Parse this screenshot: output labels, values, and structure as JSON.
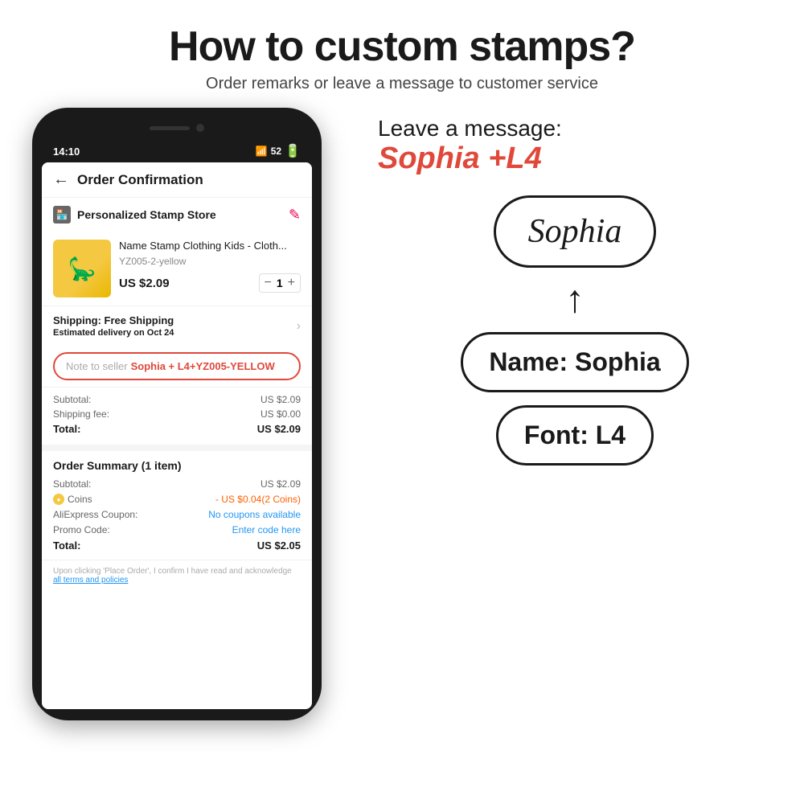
{
  "header": {
    "main_title": "How to custom stamps?",
    "subtitle": "Order remarks or leave a message to customer service"
  },
  "phone": {
    "status_bar": {
      "time": "14:10",
      "signal": "52",
      "battery": ")"
    },
    "app_header": {
      "back_icon": "←",
      "title": "Order Confirmation"
    },
    "store": {
      "name": "Personalized Stamp Store",
      "edit_icon": "✎"
    },
    "product": {
      "name": "Name Stamp Clothing Kids - Cloth...",
      "variant": "YZ005-2-yellow",
      "price": "US $2.09",
      "quantity": "1"
    },
    "shipping": {
      "title": "Shipping: Free Shipping",
      "sub": "Estimated delivery on",
      "date": "Oct 24"
    },
    "note_seller": {
      "label": "Note to seller",
      "value": "Sophia + L4+YZ005-YELLOW"
    },
    "price_summary": {
      "subtotal_label": "Subtotal:",
      "subtotal_value": "US $2.09",
      "shipping_label": "Shipping fee:",
      "shipping_value": "US $0.00",
      "total_label": "Total:",
      "total_value": "US $2.09"
    },
    "order_summary": {
      "title": "Order Summary (1 item)",
      "subtotal_label": "Subtotal:",
      "subtotal_value": "US $2.09",
      "coins_label": "Coins",
      "coins_value": "- US $0.04(2 Coins)",
      "coupon_label": "AliExpress Coupon:",
      "coupon_value": "No coupons available",
      "promo_label": "Promo Code:",
      "promo_value": "Enter code here",
      "total_label": "Total:",
      "total_value": "US $2.05"
    },
    "footer": {
      "text": "Upon clicking 'Place Order', I confirm I have read and acknowledge",
      "link_text": "all terms and policies"
    }
  },
  "right_side": {
    "leave_message_label": "Leave a message:",
    "leave_message_value": "Sophia +L4",
    "stamp_preview_text": "Sophia",
    "name_box_label": "Name: Sophia",
    "font_box_label": "Font: L4",
    "arrow": "↑"
  }
}
